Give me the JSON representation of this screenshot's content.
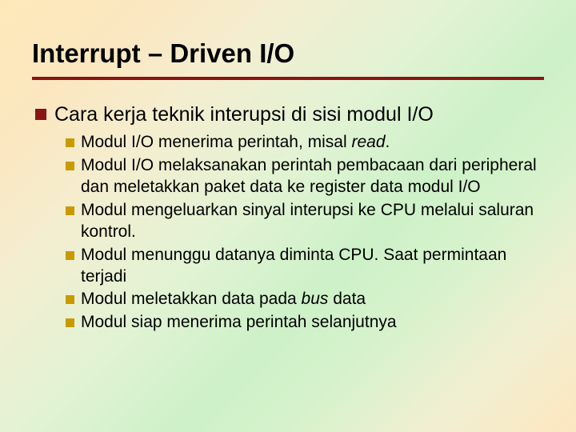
{
  "title": "Interrupt – Driven I/O",
  "l1": "Cara kerja teknik interupsi di sisi modul I/O",
  "sub": {
    "s0a": "Modul I/O menerima perintah, misal ",
    "s0b": "read",
    "s0c": ".",
    "s1": "Modul I/O melaksanakan perintah pembacaan dari peripheral dan meletakkan paket data ke register data modul I/O",
    "s2": "Modul mengeluarkan sinyal interupsi ke CPU melalui saluran kontrol.",
    "s3": "Modul menunggu datanya diminta CPU. Saat permintaan terjadi",
    "s4a": "Modul meletakkan data pada ",
    "s4b": "bus",
    "s4c": " data",
    "s5": "Modul siap menerima perintah selanjutnya"
  }
}
